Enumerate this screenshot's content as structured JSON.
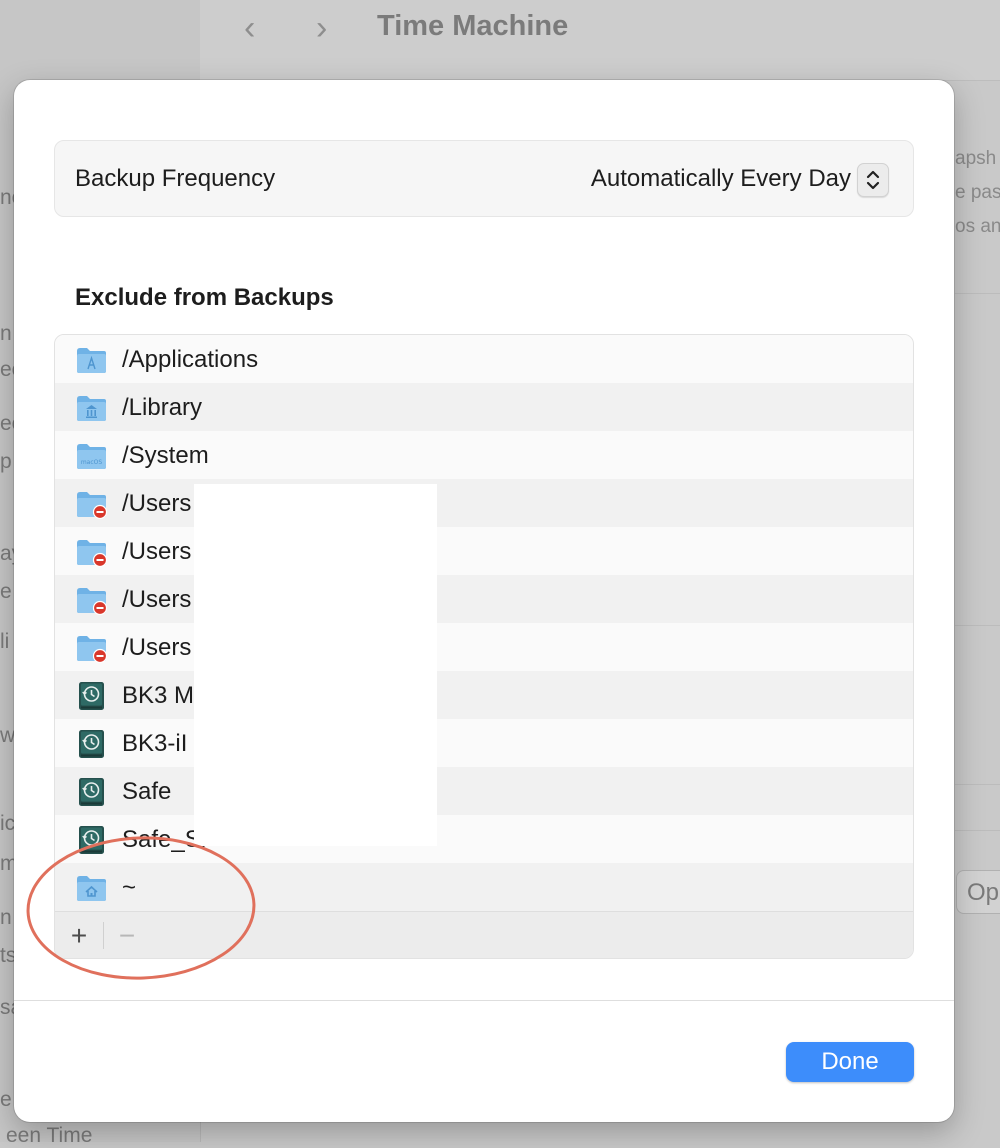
{
  "window": {
    "title": "Time Machine",
    "nav_back": "‹",
    "nav_forward": "›",
    "option_button_fragment": "Op",
    "sidebar_fragments": [
      "ne",
      "n",
      "ee",
      "ee",
      "p",
      "ay",
      "e",
      "li",
      "w",
      "ic",
      "m",
      "n",
      "ts",
      "sa",
      "e i",
      "een Time"
    ],
    "right_fragments": [
      "apsh",
      "e pas",
      "os an"
    ]
  },
  "sheet": {
    "backup_frequency": {
      "label": "Backup Frequency",
      "value": "Automatically Every Day",
      "control_icon": "up-down-chevron-icon"
    },
    "exclude": {
      "title": "Exclude from Backups",
      "items": [
        {
          "label": "/Applications",
          "icon": "applications-folder-icon"
        },
        {
          "label": "/Library",
          "icon": "library-folder-icon"
        },
        {
          "label": "/System",
          "icon": "macos-folder-icon"
        },
        {
          "label": "/Users",
          "icon": "restricted-folder-icon"
        },
        {
          "label": "/Users",
          "icon": "restricted-folder-icon"
        },
        {
          "label": "/Users",
          "icon": "restricted-folder-icon"
        },
        {
          "label": "/Users",
          "icon": "restricted-folder-icon"
        },
        {
          "label": "BK3 M",
          "icon": "time-machine-disk-icon"
        },
        {
          "label": "BK3-iI",
          "icon": "time-machine-disk-icon"
        },
        {
          "label": "Safe",
          "icon": "time-machine-disk-icon"
        },
        {
          "label": "Safe_Si",
          "icon": "time-machine-disk-icon"
        },
        {
          "label": "~",
          "icon": "home-folder-icon"
        }
      ],
      "add_label": "+",
      "remove_label": "−"
    },
    "done_label": "Done"
  },
  "colors": {
    "accent": "#3d8dfb",
    "annotation": "#e0705c",
    "folder": "#7cb8e8",
    "badge": "#d9372b",
    "disk": "#25504d"
  }
}
